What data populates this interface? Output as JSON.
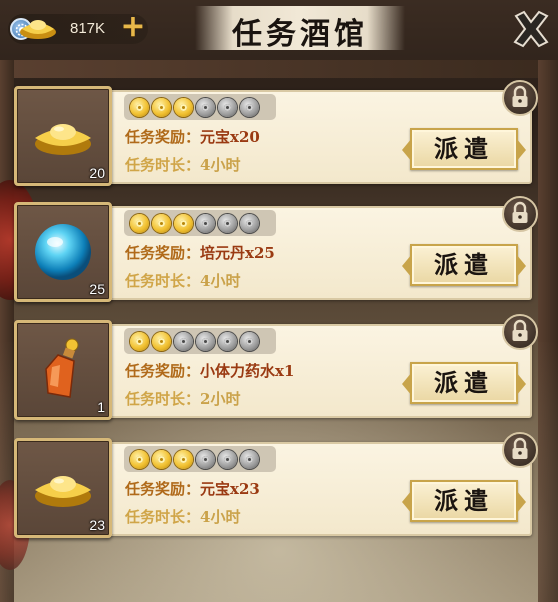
{
  "header": {
    "title": "任务酒馆",
    "currency_amount": "817K",
    "plus_label": "+"
  },
  "missions": [
    {
      "icon": "gold-ingot-icon",
      "count": "20",
      "stars_on": 3,
      "stars_total": 6,
      "reward_label": "任务奖励：",
      "reward_value": "元宝x20",
      "time_label": "任务时长：",
      "time_value": "4小时",
      "button_label": "派遣"
    },
    {
      "icon": "blue-orb-icon",
      "count": "25",
      "stars_on": 3,
      "stars_total": 6,
      "reward_label": "任务奖励：",
      "reward_value": "培元丹x25",
      "time_label": "任务时长：",
      "time_value": "4小时",
      "button_label": "派遣"
    },
    {
      "icon": "potion-bottle-icon",
      "count": "1",
      "stars_on": 2,
      "stars_total": 6,
      "reward_label": "任务奖励：",
      "reward_value": "小体力药水x1",
      "time_label": "任务时长：",
      "time_value": "2小时",
      "button_label": "派遣"
    },
    {
      "icon": "gold-ingot-icon",
      "count": "23",
      "stars_on": 3,
      "stars_total": 6,
      "reward_label": "任务奖励：",
      "reward_value": "元宝x23",
      "time_label": "任务时长：",
      "time_value": "4小时",
      "button_label": "派遣"
    }
  ],
  "colors": {
    "reward_text": "#9a3a12",
    "time_text": "#caa24a",
    "card_bg": "#fbf4e2",
    "gold": "#f2c233"
  }
}
